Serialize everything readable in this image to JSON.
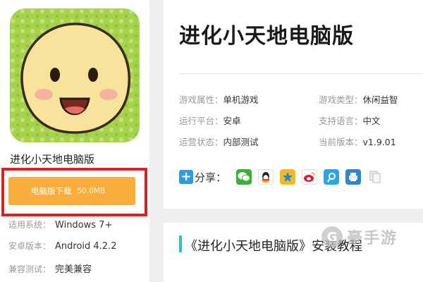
{
  "app": {
    "name": "进化小天地电脑版",
    "icon_name": "smiling-blob-icon"
  },
  "download": {
    "label": "电脑版下载",
    "size": "50.0MB",
    "button_color": "#f8ad3c",
    "highlight_color": "#e02020"
  },
  "specs": [
    {
      "key": "适用系统：",
      "value": "Windows 7+"
    },
    {
      "key": "安卓版本：",
      "value": "Android 4.2.2"
    },
    {
      "key": "兼容测试：",
      "value": "完美兼容"
    }
  ],
  "detail": {
    "title": "进化小天地电脑版",
    "attributes": [
      {
        "key": "游戏属性：",
        "value": "单机游戏"
      },
      {
        "key": "游戏类型：",
        "value": "休闲益智"
      },
      {
        "key": "运行平台：",
        "value": "安卓"
      },
      {
        "key": "支持语言：",
        "value": "中文"
      },
      {
        "key": "运营状态：",
        "value": "内部测试"
      },
      {
        "key": "当前版本：",
        "value": "v1.9.01"
      }
    ]
  },
  "share": {
    "label": "分享：",
    "icons": [
      "wechat-icon",
      "qq-icon",
      "qzone-icon",
      "weibo-icon",
      "tencent-weibo-icon",
      "print-icon",
      "copy-icon"
    ]
  },
  "section": {
    "title": "《进化小天地电脑版》安装教程",
    "accent_color": "#2ec0d0"
  },
  "watermark": {
    "text": "豪手游"
  }
}
